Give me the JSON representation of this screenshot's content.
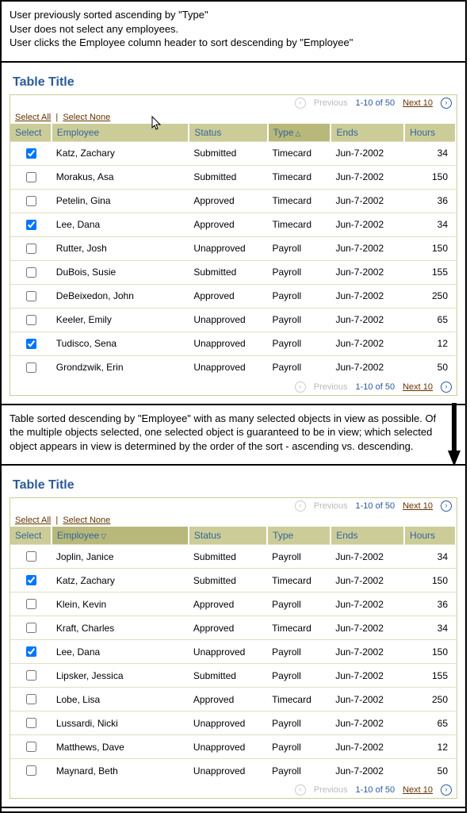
{
  "sections": {
    "top_desc": "User previously sorted ascending by \"Type\"\nUser does not select any employees.\nUser clicks the Employee column header to sort descending by \"Employee\"",
    "mid_desc": "Table sorted descending by \"Employee\" with as many selected objects in view as possible. Of the multiple objects selected, one selected object is guaranteed to be in view; which selected object appears in view is determined by the order of the sort - ascending vs. descending."
  },
  "common": {
    "title": "Table Title",
    "select_all": "Select All",
    "select_none": "Select None",
    "previous": "Previous",
    "range": "1-10 of 50",
    "next": "Next 10"
  },
  "columns": {
    "select": "Select",
    "employee": "Employee",
    "status": "Status",
    "type": "Type",
    "ends": "Ends",
    "hours": "Hours"
  },
  "table1": {
    "sorted_col": "type",
    "sort_dir": "asc",
    "rows": [
      {
        "sel": true,
        "emp": "Katz, Zachary",
        "status": "Submitted",
        "type": "Timecard",
        "ends": "Jun-7-2002",
        "hours": 34
      },
      {
        "sel": false,
        "emp": "Morakus, Asa",
        "status": "Submitted",
        "type": "Timecard",
        "ends": "Jun-7-2002",
        "hours": 150
      },
      {
        "sel": false,
        "emp": "Petelin, Gina",
        "status": "Approved",
        "type": "Timecard",
        "ends": "Jun-7-2002",
        "hours": 36
      },
      {
        "sel": true,
        "emp": "Lee, Dana",
        "status": "Approved",
        "type": "Timecard",
        "ends": "Jun-7-2002",
        "hours": 34
      },
      {
        "sel": false,
        "emp": "Rutter, Josh",
        "status": "Unapproved",
        "type": "Payroll",
        "ends": "Jun-7-2002",
        "hours": 150
      },
      {
        "sel": false,
        "emp": "DuBois, Susie",
        "status": "Submitted",
        "type": "Payroll",
        "ends": "Jun-7-2002",
        "hours": 155
      },
      {
        "sel": false,
        "emp": "DeBeixedon, John",
        "status": "Approved",
        "type": "Payroll",
        "ends": "Jun-7-2002",
        "hours": 250
      },
      {
        "sel": false,
        "emp": "Keeler, Emily",
        "status": "Unapproved",
        "type": "Payroll",
        "ends": "Jun-7-2002",
        "hours": 65
      },
      {
        "sel": true,
        "emp": "Tudisco, Sena",
        "status": "Unapproved",
        "type": "Payroll",
        "ends": "Jun-7-2002",
        "hours": 12
      },
      {
        "sel": false,
        "emp": "Grondzwik, Erin",
        "status": "Unapproved",
        "type": "Payroll",
        "ends": "Jun-7-2002",
        "hours": 50
      }
    ]
  },
  "table2": {
    "sorted_col": "employee",
    "sort_dir": "desc",
    "rows": [
      {
        "sel": false,
        "emp": "Joplin, Janice",
        "status": "Submitted",
        "type": "Payroll",
        "ends": "Jun-7-2002",
        "hours": 34
      },
      {
        "sel": true,
        "emp": "Katz, Zachary",
        "status": "Submitted",
        "type": "Timecard",
        "ends": "Jun-7-2002",
        "hours": 150
      },
      {
        "sel": false,
        "emp": "Klein, Kevin",
        "status": "Approved",
        "type": "Payroll",
        "ends": "Jun-7-2002",
        "hours": 36
      },
      {
        "sel": false,
        "emp": "Kraft, Charles",
        "status": "Approved",
        "type": "Timecard",
        "ends": "Jun-7-2002",
        "hours": 34
      },
      {
        "sel": true,
        "emp": "Lee, Dana",
        "status": "Unapproved",
        "type": "Payroll",
        "ends": "Jun-7-2002",
        "hours": 150
      },
      {
        "sel": false,
        "emp": "Lipsker, Jessica",
        "status": "Submitted",
        "type": "Payroll",
        "ends": "Jun-7-2002",
        "hours": 155
      },
      {
        "sel": false,
        "emp": "Lobe, Lisa",
        "status": "Approved",
        "type": "Timecard",
        "ends": "Jun-7-2002",
        "hours": 250
      },
      {
        "sel": false,
        "emp": "Lussardi, Nicki",
        "status": "Unapproved",
        "type": "Payroll",
        "ends": "Jun-7-2002",
        "hours": 65
      },
      {
        "sel": false,
        "emp": "Matthews, Dave",
        "status": "Unapproved",
        "type": "Payroll",
        "ends": "Jun-7-2002",
        "hours": 12
      },
      {
        "sel": false,
        "emp": "Maynard, Beth",
        "status": "Unapproved",
        "type": "Payroll",
        "ends": "Jun-7-2002",
        "hours": 50
      }
    ]
  }
}
